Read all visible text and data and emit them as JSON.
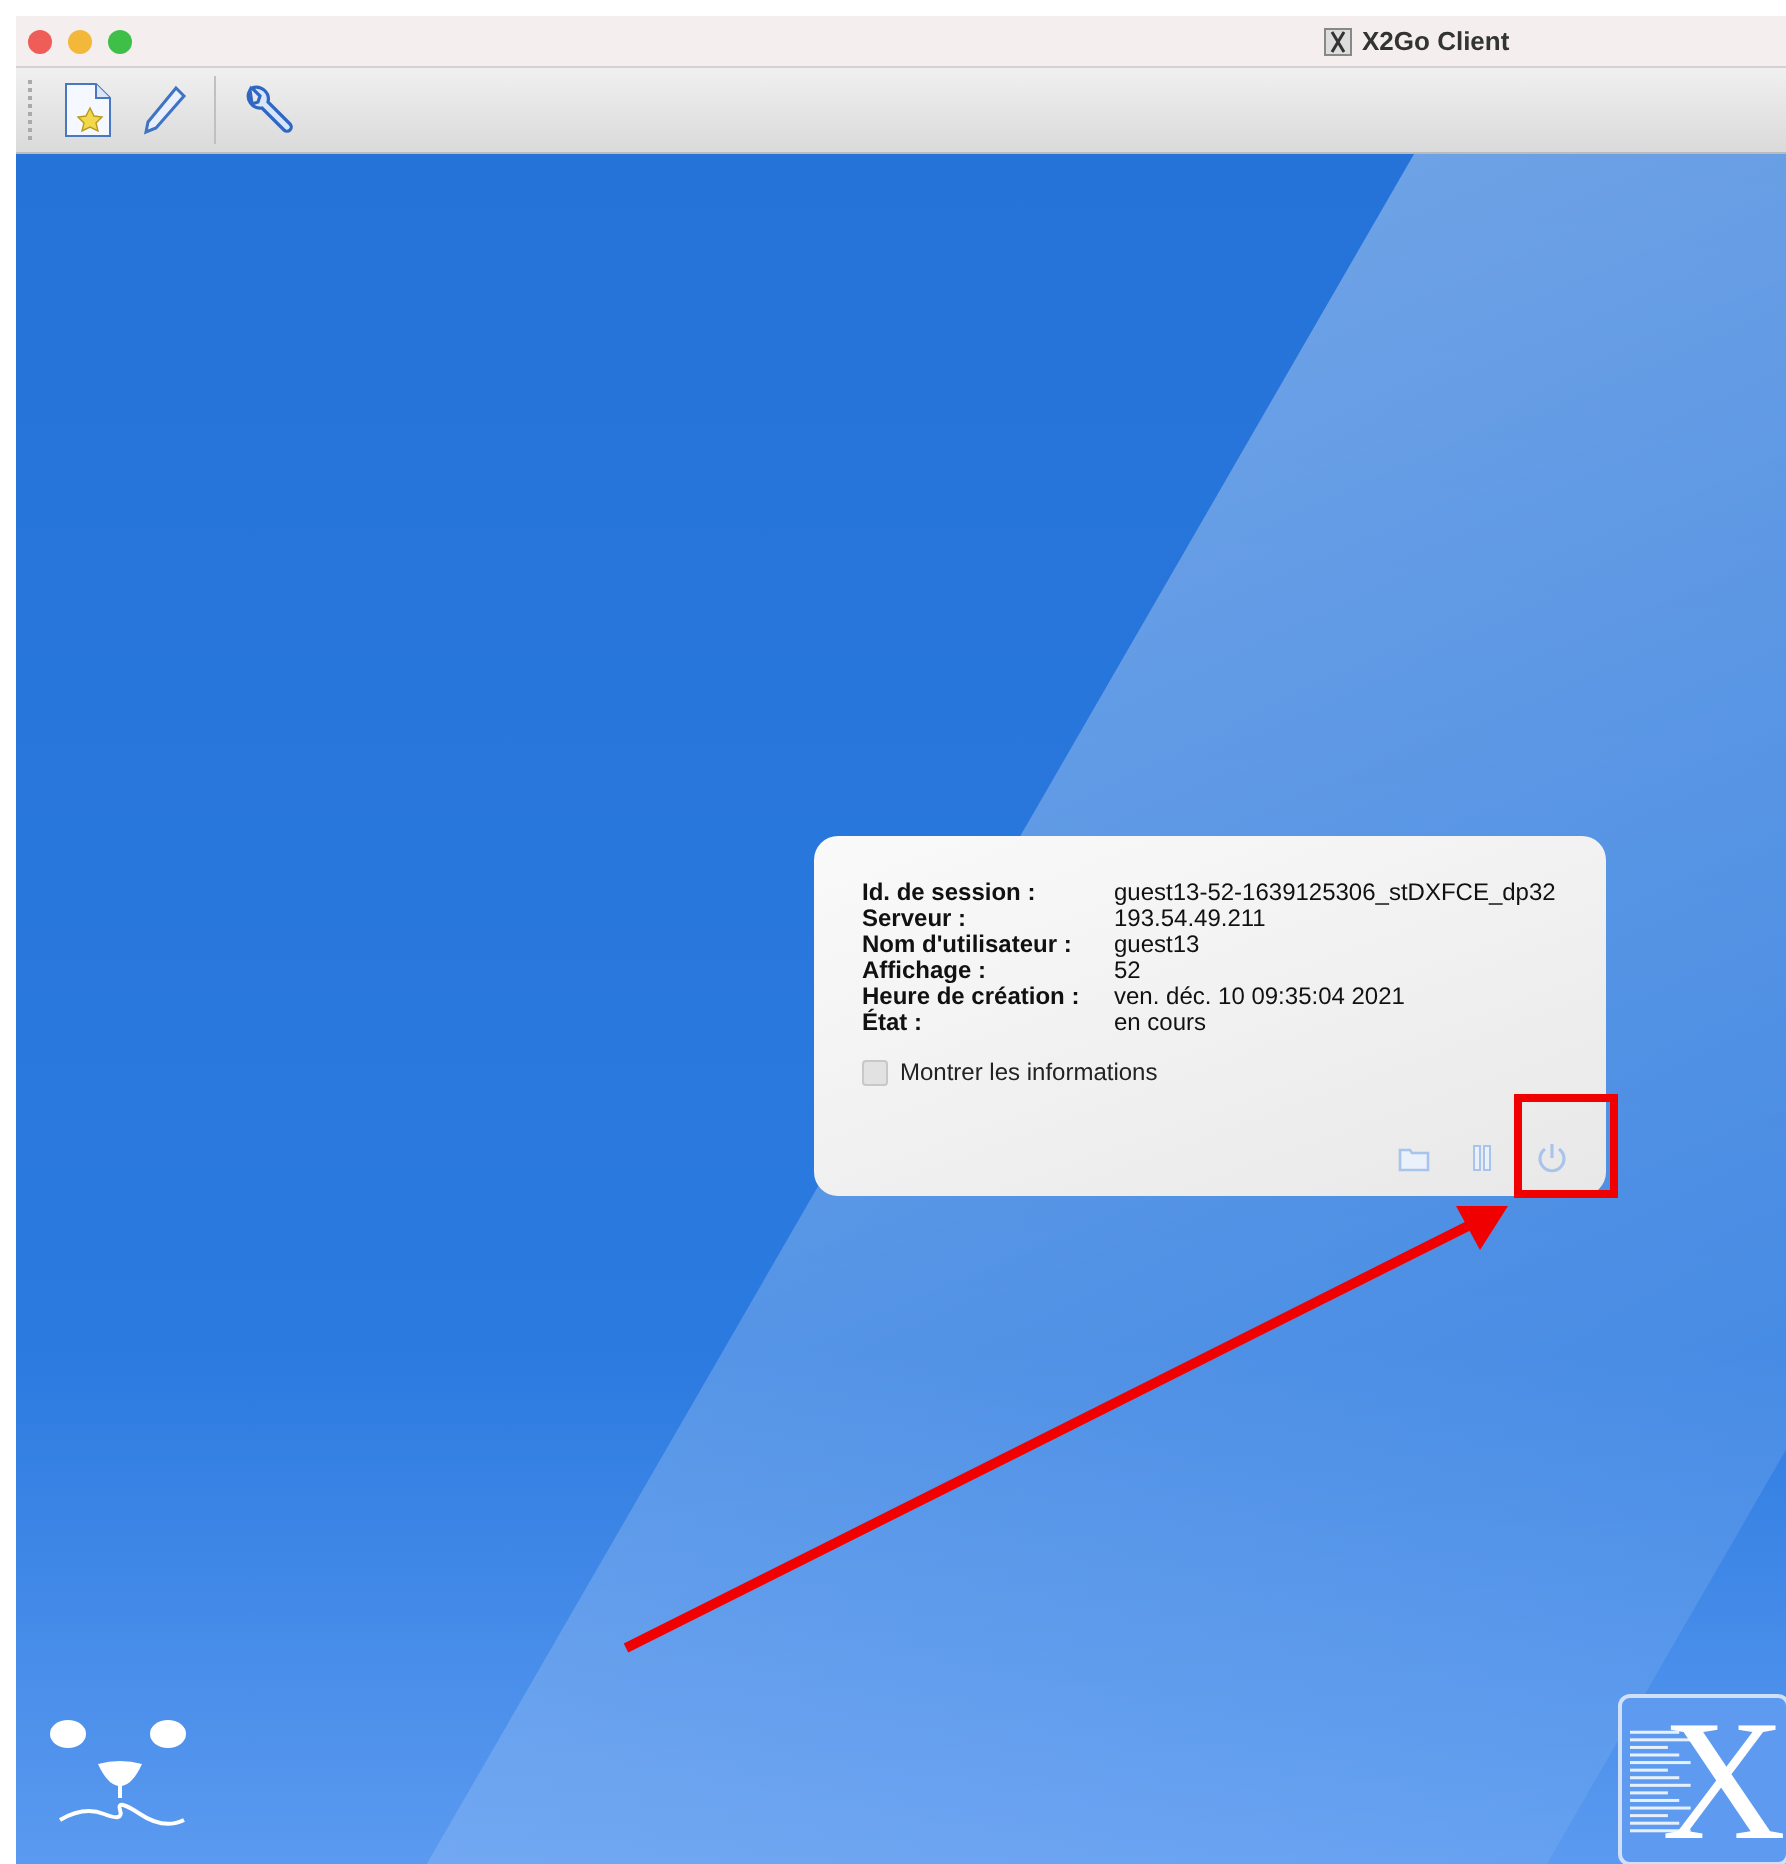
{
  "window": {
    "title": "X2Go Client"
  },
  "toolbar": {
    "buttons": [
      {
        "kind": "new-session"
      },
      {
        "kind": "edit"
      },
      {
        "kind": "settings"
      }
    ]
  },
  "session_card": {
    "fields": [
      {
        "label": "Id. de session :",
        "value": "guest13-52-1639125306_stDXFCE_dp32"
      },
      {
        "label": "Serveur :",
        "value": "193.54.49.211"
      },
      {
        "label": "Nom d'utilisateur :",
        "value": "guest13"
      },
      {
        "label": "Affichage :",
        "value": "52"
      },
      {
        "label": "Heure de création :",
        "value": "ven. déc. 10 09:35:04 2021"
      },
      {
        "label": "État :",
        "value": "en cours"
      }
    ],
    "show_info": {
      "label": "Montrer les informations",
      "checked": false
    },
    "actions": [
      {
        "kind": "folder"
      },
      {
        "kind": "pause"
      },
      {
        "kind": "power"
      }
    ]
  },
  "logo": {
    "letter": "X"
  }
}
